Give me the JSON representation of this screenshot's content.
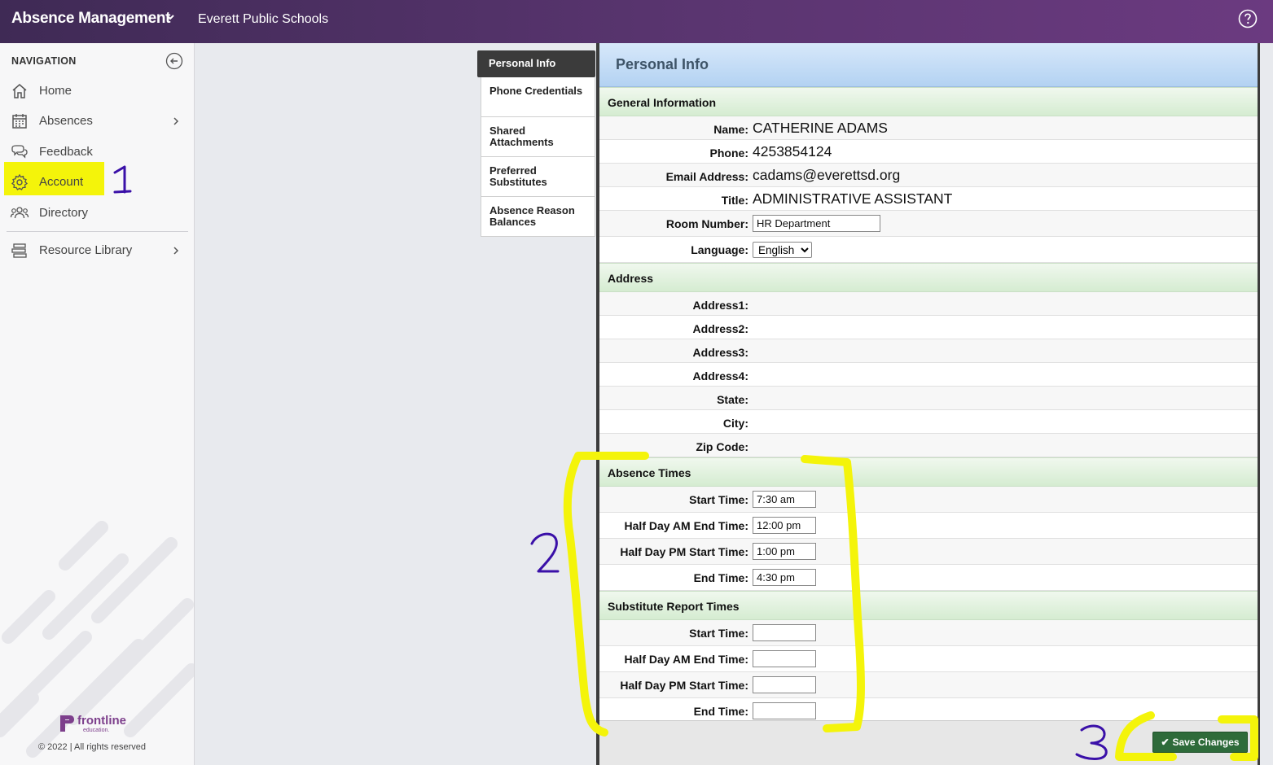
{
  "header": {
    "app_title": "Absence Management",
    "org_name": "Everett Public Schools",
    "help_icon": "help-circle-icon"
  },
  "sidebar": {
    "heading": "NAVIGATION",
    "items": [
      {
        "label": "Home",
        "icon": "home-icon"
      },
      {
        "label": "Absences",
        "icon": "calendar-icon",
        "has_submenu": true
      },
      {
        "label": "Feedback",
        "icon": "chat-icon"
      },
      {
        "label": "Account",
        "icon": "gear-icon",
        "highlighted": true
      },
      {
        "label": "Directory",
        "icon": "people-icon"
      },
      {
        "label": "Resource Library",
        "icon": "library-icon",
        "has_submenu": true
      }
    ],
    "footer_logo": "frontline",
    "footer_logo_sub": "education.",
    "footer_text": "© 2022 | All rights reserved"
  },
  "tabs": [
    {
      "label": "Personal Info",
      "active": true
    },
    {
      "label": "Phone Credentials"
    },
    {
      "label": "Shared Attachments"
    },
    {
      "label": "Preferred Substitutes"
    },
    {
      "label": "Absence Reason Balances"
    }
  ],
  "panel": {
    "title": "Personal Info",
    "general": {
      "heading": "General Information",
      "name_label": "Name:",
      "name": "CATHERINE ADAMS",
      "phone_label": "Phone:",
      "phone": "4253854124",
      "email_label": "Email Address:",
      "email": "cadams@everettsd.org",
      "title_label": "Title:",
      "title": "ADMINISTRATIVE ASSISTANT",
      "room_label": "Room Number:",
      "room": "HR Department",
      "language_label": "Language:",
      "language": "English"
    },
    "address": {
      "heading": "Address",
      "labels": [
        "Address1:",
        "Address2:",
        "Address3:",
        "Address4:",
        "State:",
        "City:",
        "Zip Code:"
      ]
    },
    "absence_times": {
      "heading": "Absence Times",
      "start_label": "Start Time:",
      "start": "7:30 am",
      "am_end_label": "Half Day AM End Time:",
      "am_end": "12:00 pm",
      "pm_start_label": "Half Day PM Start Time:",
      "pm_start": "1:00 pm",
      "end_label": "End Time:",
      "end": "4:30 pm"
    },
    "substitute_times": {
      "heading": "Substitute Report Times",
      "start_label": "Start Time:",
      "start": "",
      "am_end_label": "Half Day AM End Time:",
      "am_end": "",
      "pm_start_label": "Half Day PM Start Time:",
      "pm_start": "",
      "end_label": "End Time:",
      "end": ""
    },
    "save_label": "Save Changes"
  },
  "annotations": {
    "one": "1",
    "two": "2",
    "three": "3",
    "marker_color": "#f4f40a",
    "ink_color": "#3a10a8"
  }
}
